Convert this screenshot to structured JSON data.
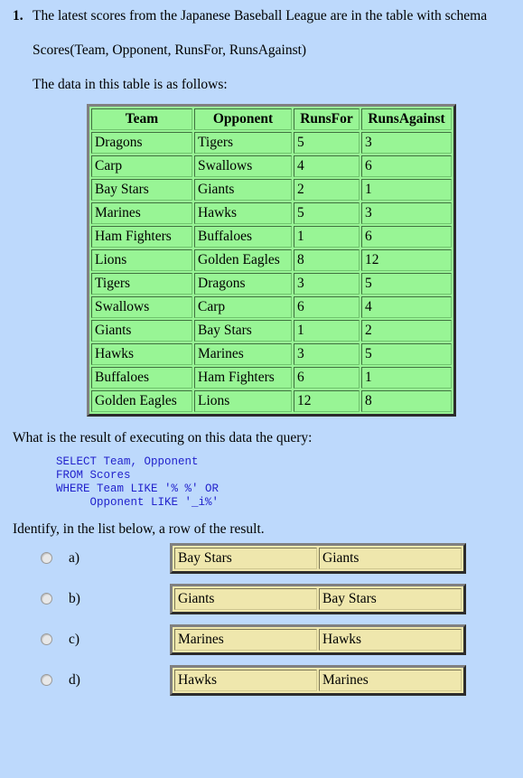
{
  "question": {
    "number": "1.",
    "intro": "The latest scores from the Japanese Baseball League are in the table with schema",
    "schema": "Scores(Team, Opponent, RunsFor, RunsAgainst)",
    "data_intro": "The data in this table is as follows:",
    "query_prompt": "What is the result of executing on this data the query:",
    "sql": "SELECT Team, Opponent\nFROM Scores\nWHERE Team LIKE '% %' OR\n     Opponent LIKE '_i%'",
    "identify_prompt": "Identify, in the list below, a row of the result."
  },
  "scores_table": {
    "headers": [
      "Team",
      "Opponent",
      "RunsFor",
      "RunsAgainst"
    ],
    "rows": [
      [
        "Dragons",
        "Tigers",
        "5",
        "3"
      ],
      [
        "Carp",
        "Swallows",
        "4",
        "6"
      ],
      [
        "Bay Stars",
        "Giants",
        "2",
        "1"
      ],
      [
        "Marines",
        "Hawks",
        "5",
        "3"
      ],
      [
        "Ham Fighters",
        "Buffaloes",
        "1",
        "6"
      ],
      [
        "Lions",
        "Golden Eagles",
        "8",
        "12"
      ],
      [
        "Tigers",
        "Dragons",
        "3",
        "5"
      ],
      [
        "Swallows",
        "Carp",
        "6",
        "4"
      ],
      [
        "Giants",
        "Bay Stars",
        "1",
        "2"
      ],
      [
        "Hawks",
        "Marines",
        "3",
        "5"
      ],
      [
        "Buffaloes",
        "Ham Fighters",
        "6",
        "1"
      ],
      [
        "Golden Eagles",
        "Lions",
        "12",
        "8"
      ]
    ]
  },
  "options": [
    {
      "label": "a)",
      "cells": [
        "Bay Stars",
        "Giants"
      ],
      "selected": false
    },
    {
      "label": "b)",
      "cells": [
        "Giants",
        "Bay Stars"
      ],
      "selected": false
    },
    {
      "label": "c)",
      "cells": [
        "Marines",
        "Hawks"
      ],
      "selected": false
    },
    {
      "label": "d)",
      "cells": [
        "Hawks",
        "Marines"
      ],
      "selected": false
    }
  ],
  "colors": {
    "page_background": "#bdd9fc",
    "table_cell_green": "#98f595",
    "answer_cell_yellow": "#efe7ad",
    "sql_text": "#2222cc",
    "border_gray": "#808080"
  }
}
